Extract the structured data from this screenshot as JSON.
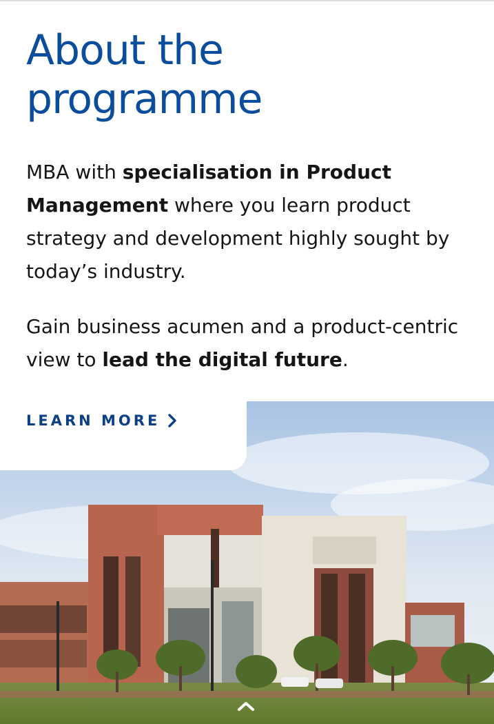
{
  "about": {
    "heading_line1": "About the",
    "heading_line2": "programme",
    "p1_text1": "MBA with ",
    "p1_bold1": "specialisation in Product Management",
    "p1_text2": " where you learn product strategy and development highly sought by today’s industry.",
    "p2_text1": "Gain business acumen and a product-centric view to ",
    "p2_bold1": "lead the digital future",
    "p2_text2": "."
  },
  "cta": {
    "learn_more_label": "LEARN MORE"
  },
  "icons": {
    "learn_more": "chevron-right-icon",
    "scroll_top": "chevron-up-icon"
  },
  "colors": {
    "heading": "#0a4d9c",
    "cta": "#0d3f86",
    "text": "#151515"
  }
}
